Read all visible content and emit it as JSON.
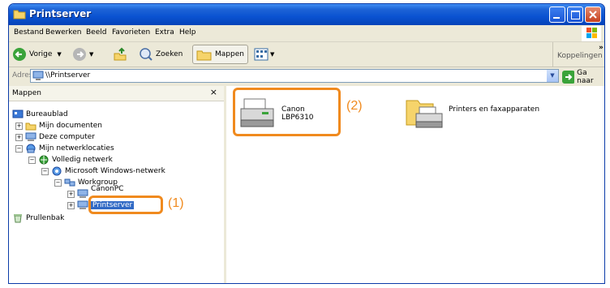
{
  "window": {
    "title": "Printserver"
  },
  "menu": [
    "Bestand",
    "Bewerken",
    "Beeld",
    "Favorieten",
    "Extra",
    "Help"
  ],
  "toolbar": {
    "back_label": "Vorige",
    "search_label": "Zoeken",
    "folders_label": "Mappen",
    "links_label": "Koppelingen",
    "chevron": "»"
  },
  "address": {
    "label": "Adres",
    "value": "\\\\Printserver",
    "go_label": "Ga naar"
  },
  "leftpane": {
    "title": "Mappen",
    "close": "×",
    "tree": [
      {
        "label": "Bureaublad",
        "icon": "desktop-icon"
      },
      {
        "label": "Mijn documenten",
        "icon": "folder-icon",
        "expander": "+"
      },
      {
        "label": "Deze computer",
        "icon": "computer-icon",
        "expander": "+"
      },
      {
        "label": "Mijn netwerklocaties",
        "icon": "network-places-icon",
        "expander": "−"
      },
      {
        "label": "Volledig netwerk",
        "icon": "entire-network-icon",
        "expander": "−"
      },
      {
        "label": "Microsoft Windows-netwerk",
        "icon": "windows-network-icon",
        "expander": "−"
      },
      {
        "label": "Workgroup",
        "icon": "workgroup-icon",
        "expander": "−"
      },
      {
        "label": "CanonPC",
        "icon": "computer-icon",
        "expander": "+"
      },
      {
        "label": "Printserver",
        "icon": "computer-icon",
        "expander": "+"
      },
      {
        "label": "Prullenbak",
        "icon": "recycle-bin-icon"
      }
    ]
  },
  "content": {
    "items": [
      {
        "label": "Canon LBP6310",
        "icon": "printer-icon"
      },
      {
        "label": "Printers en faxapparaten",
        "icon": "printers-folder-icon"
      }
    ]
  },
  "callouts": {
    "one": "(1)",
    "two": "(2)"
  },
  "colors": {
    "title_blue": "#0a52d1",
    "callout_orange": "#f08a1e",
    "selection": "#316ac5"
  }
}
